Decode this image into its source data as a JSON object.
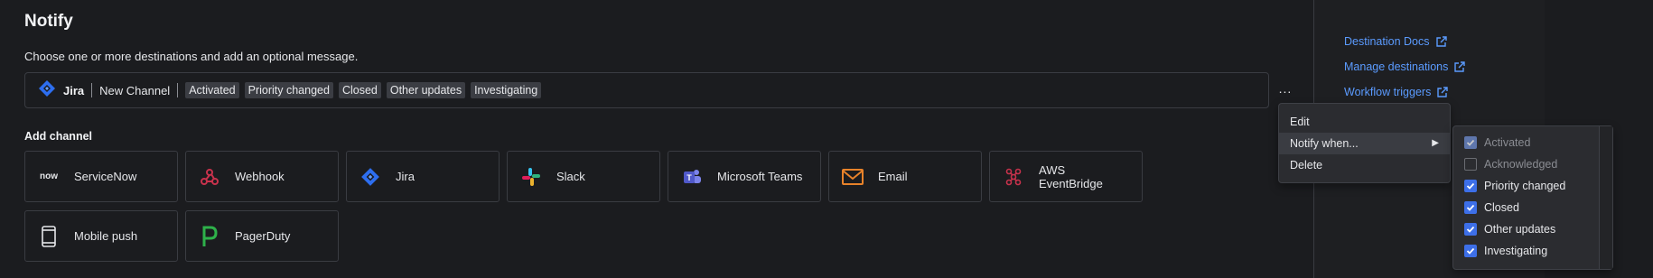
{
  "section": {
    "title": "Notify",
    "subtitle": "Choose one or more destinations and add an optional message."
  },
  "configured_channel": {
    "type": "Jira",
    "name": "New Channel",
    "tags": [
      "Activated",
      "Priority changed",
      "Closed",
      "Other updates",
      "Investigating"
    ],
    "more_label": "..."
  },
  "add_channel": {
    "label": "Add channel",
    "tiles": [
      {
        "label": "ServiceNow",
        "icon": "servicenow-icon"
      },
      {
        "label": "Webhook",
        "icon": "webhook-icon"
      },
      {
        "label": "Jira",
        "icon": "jira-icon"
      },
      {
        "label": "Slack",
        "icon": "slack-icon"
      },
      {
        "label": "Microsoft Teams",
        "icon": "teams-icon"
      },
      {
        "label": "Email",
        "icon": "email-icon"
      },
      {
        "label": "AWS EventBridge",
        "icon": "eventbridge-icon"
      },
      {
        "label": "Mobile push",
        "icon": "mobile-icon"
      },
      {
        "label": "PagerDuty",
        "icon": "pagerduty-icon"
      }
    ]
  },
  "sidebar_links": [
    {
      "label": "Destination Docs"
    },
    {
      "label": "Manage destinations"
    },
    {
      "label": "Workflow triggers"
    }
  ],
  "context_menu": {
    "items": [
      {
        "label": "Edit"
      },
      {
        "label": "Notify when..."
      },
      {
        "label": "Delete"
      }
    ]
  },
  "notify_when_submenu": {
    "options": [
      {
        "label": "Activated",
        "checked": true,
        "disabled": true
      },
      {
        "label": "Acknowledged",
        "checked": false,
        "disabled": true
      },
      {
        "label": "Priority changed",
        "checked": true,
        "disabled": false
      },
      {
        "label": "Closed",
        "checked": true,
        "disabled": false
      },
      {
        "label": "Other updates",
        "checked": true,
        "disabled": false
      },
      {
        "label": "Investigating",
        "checked": true,
        "disabled": false
      }
    ]
  },
  "colors": {
    "accent": "#3d6fe8",
    "link": "#5b9bff",
    "background": "#1b1c1f"
  },
  "servicenow_logo_text": "now"
}
